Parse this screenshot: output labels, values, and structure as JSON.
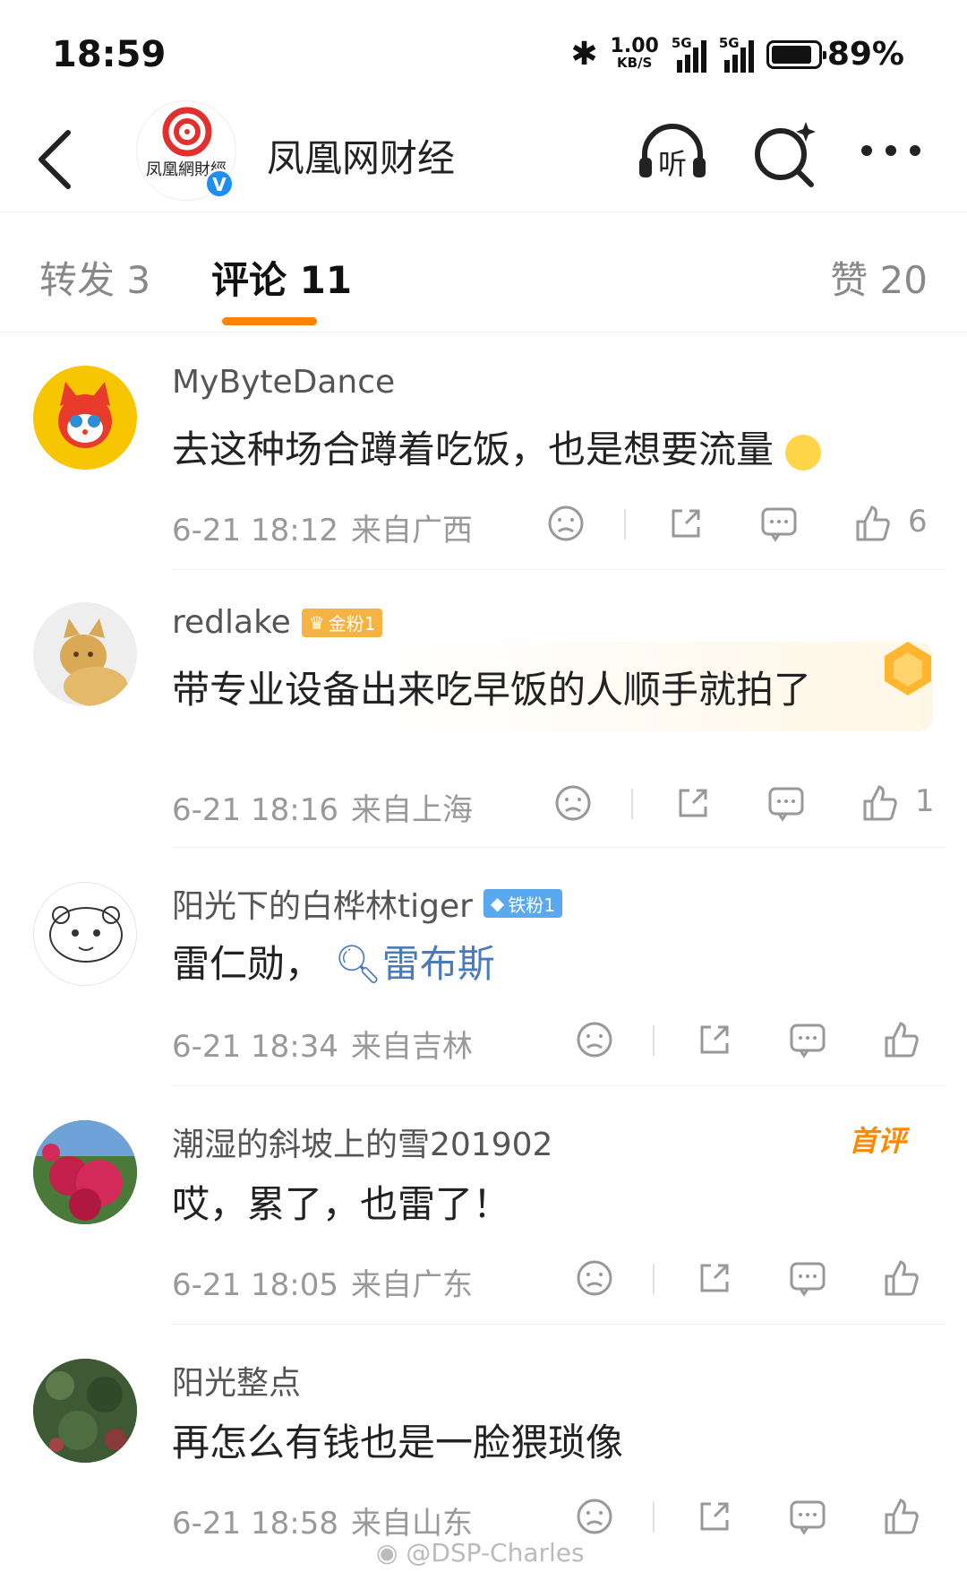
{
  "status": {
    "time": "18:59",
    "speed_num": "1.00",
    "speed_unit": "KB/S",
    "sig1": "5G",
    "sig2": "5G",
    "battery_level": 0.89,
    "battery": "89%"
  },
  "nav": {
    "title": "凤凰网财经",
    "logo_text": "凤凰網財經",
    "verified": "V",
    "listen_icon": "listen-icon",
    "search_icon": "ai-search-icon",
    "more_icon": "more-icon"
  },
  "tabs": [
    {
      "label": "转发 3"
    },
    {
      "label": "评论 11"
    },
    {
      "label": "赞 20"
    }
  ],
  "comments": [
    {
      "user": "MyByteDance",
      "text": "去这种场合蹲着吃饭，也是想要流量",
      "emoji": "thinking-emoji",
      "time": "6-21 18:12",
      "loc": "来自广西",
      "likes": "6",
      "avatar_color": "#f7c600"
    },
    {
      "user": "redlake",
      "badge": "金粉1",
      "text": "带专业设备出来吃早饭的人顺手就拍了",
      "time": "6-21 18:16",
      "loc": "来自上海",
      "likes": "1",
      "avatar_color": "#d9a955"
    },
    {
      "user": "阳光下的白桦林tiger",
      "badge": "铁粉1",
      "text_plain": "雷仁勋，",
      "topic": "雷布斯",
      "time": "6-21 18:34",
      "loc": "来自吉林",
      "likes": "",
      "avatar_color": "#ffffff"
    },
    {
      "user": "潮湿的斜坡上的雪201902",
      "first_label": "首评",
      "text": "哎，累了，也雷了！",
      "time": "6-21 18:05",
      "loc": "来自广东",
      "likes": "",
      "avatar_color": "#c2204a"
    },
    {
      "user": "阳光整点",
      "text": "再怎么有钱也是一脸猥琐像",
      "time": "6-21 18:58",
      "loc": "来自山东",
      "likes": "",
      "avatar_color": "#3d5a34"
    }
  ],
  "watermark": "@DSP-Charles",
  "colors": {
    "accent": "#ff8200",
    "topic": "#4a7ab8",
    "verified": "#1f8ef1"
  }
}
